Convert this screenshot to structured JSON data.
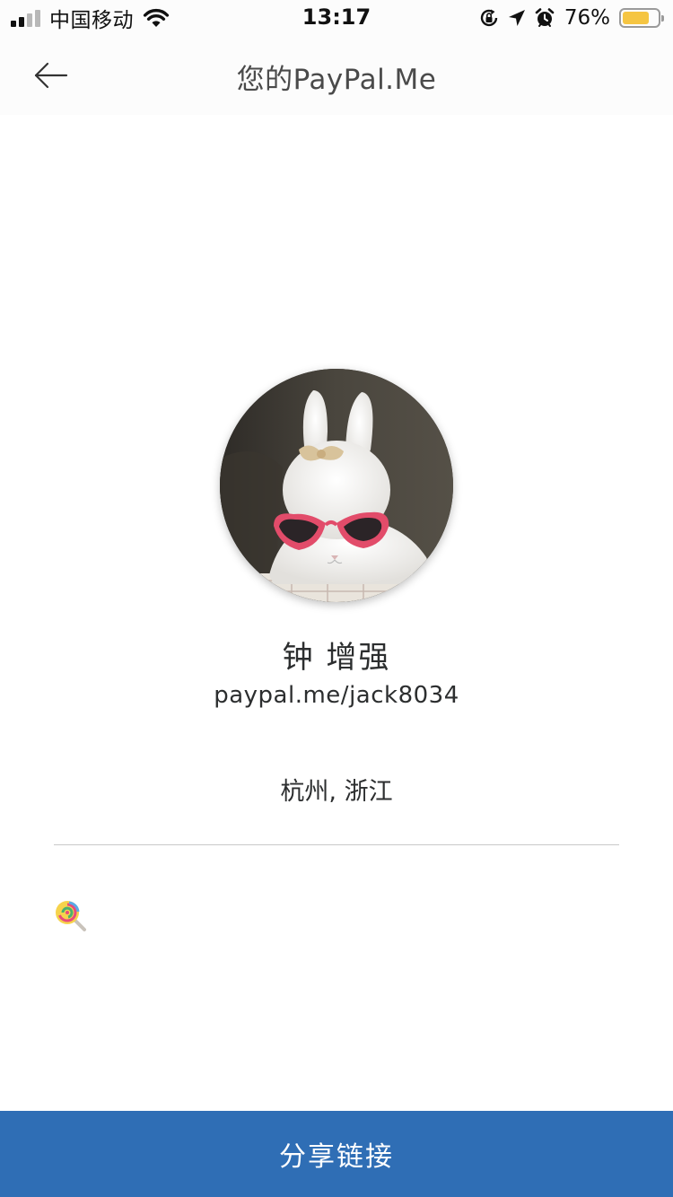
{
  "status_bar": {
    "carrier": "中国移动",
    "time": "13:17",
    "battery_percent": "76%",
    "battery_level": 0.76,
    "battery_color": "#f5c542",
    "icons": [
      "signal-icon",
      "wifi-icon",
      "orientation-lock-icon",
      "location-arrow-icon",
      "alarm-icon",
      "battery-icon"
    ]
  },
  "nav": {
    "title": "您的PayPal.Me",
    "back_icon": "arrow-left-icon"
  },
  "profile": {
    "avatar_icon": "profile-photo",
    "name": "钟 增强",
    "link": "paypal.me/jack8034",
    "location": "杭州, 浙江",
    "bio_emoji": "🍭"
  },
  "share_button": {
    "label": "分享链接",
    "color": "#2f6eb5"
  }
}
